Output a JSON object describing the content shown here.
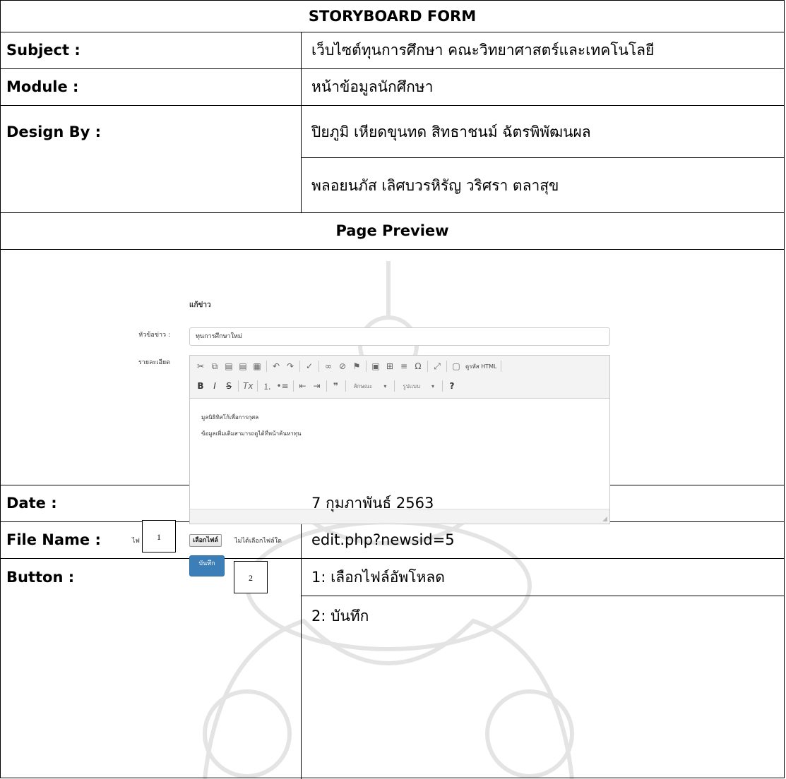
{
  "form": {
    "title": "STORYBOARD FORM",
    "subject_label": "Subject  :",
    "subject_value": "เว็บไซต์ทุนการศึกษา คณะวิทยาศาสตร์และเทคโนโลยี",
    "module_label": "Module :",
    "module_value": "หน้าข้อมูลนักศึกษา",
    "design_label": "Design By  :",
    "design_line1": "ปิยภูมิ เหียดขุนทด  สิทธาชนม์ ฉัตรพิพัฒนผล",
    "design_line2": "พลอยนภัส เลิศบวรหิรัญ  วริศรา ตลาสุข",
    "preview_heading": "Page Preview",
    "date_label": "Date  :",
    "date_value": "7 กุมภาพันธ์ 2563",
    "filename_label": "File Name  :",
    "filename_value": "edit.php?newsid=5",
    "button_label": "Button  :",
    "button_1": "1: เลือกไฟล์อัพโหลด",
    "button_2": "2: บันทึก"
  },
  "preview": {
    "page_title": "แก้ข่าว",
    "headline_label": "หัวข้อข่าว :",
    "headline_value": "ทุนการศึกษาใหม่",
    "detail_label": "รายละเอียด",
    "toolbar_source": "ดูรหัส HTML",
    "toolbar_format_dd": "ลักษณะ",
    "toolbar_style_dd": "รูปแบบ",
    "toolbar_help": "?",
    "body_line1": "มูลนิธิทิสโก้เพื่อการกุศล",
    "body_line2": "ข้อมูลเพิ่มเติมสามารถดูได้ที่หน้าค้นหาทุน",
    "file_label": "ไฟ",
    "file_button": "เลือกไฟล์",
    "file_status": "ไม่ได้เลือกไฟล์ใด",
    "save_button": "บันทึก",
    "callout_1": "1",
    "callout_2": "2"
  }
}
